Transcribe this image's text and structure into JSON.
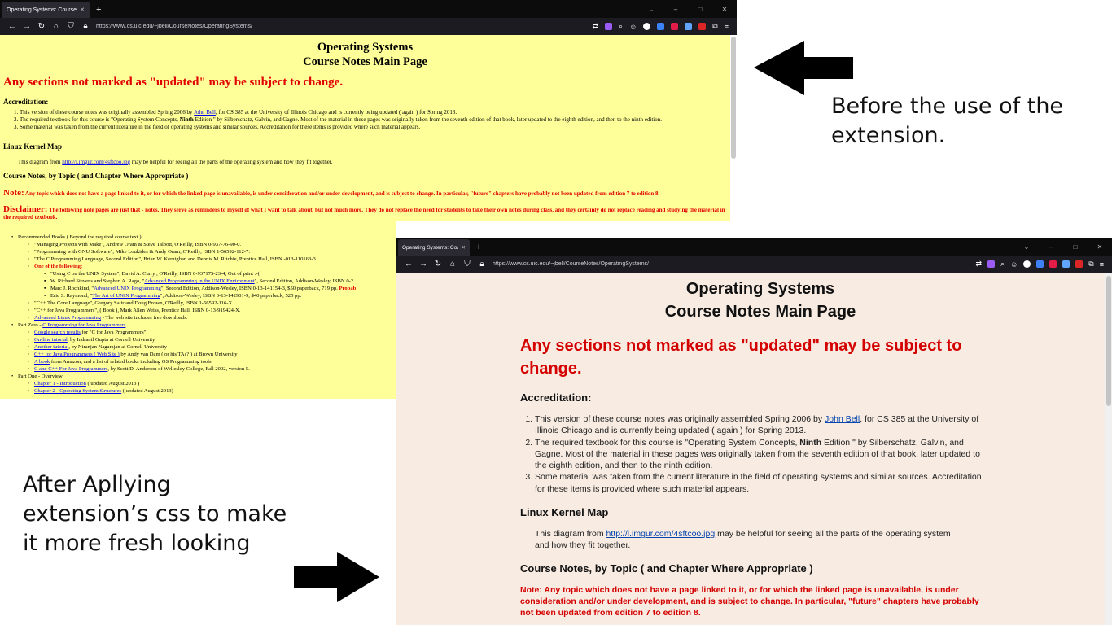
{
  "before": {
    "tab_title": "Operating Systems: Course Notes M",
    "new_tab_label": "+",
    "window_controls": [
      "⌄",
      "–",
      "□",
      "✕"
    ],
    "url": "https://www.cs.uic.edu/~jbell/CourseNotes/OperatingSystems/",
    "page_title_line1": "Operating Systems",
    "page_title_line2": "Course Notes Main Page",
    "warning": "Any sections not marked as \"updated\" may be subject to change.",
    "accreditation_heading": "Accreditation:",
    "accreditation_items": [
      {
        "pre": "This version of these course notes was originally assembled Spring 2006 by ",
        "link": "John Bell",
        "post": ", for CS 385 at the University of Illinois Chicago and is currently being updated ( again ) for Spring 2013."
      },
      {
        "pre": "The required textbook for this course is \"Operating System Concepts, ",
        "bold": "Ninth",
        "post": " Edition \" by Silberschatz, Galvin, and Gagne. Most of the material in these pages was originally taken from the seventh edition of that book, later updated to the eighth edition, and then to the ninth edition."
      },
      {
        "pre": "Some material was taken from the current literature in the field of operating systems and similar sources. Accreditation for these items is provided where such material appears."
      }
    ],
    "kernel_heading": "Linux Kernel Map",
    "kernel_pre": "This diagram from ",
    "kernel_link": "http://i.imgur.com/4sftcoo.jpg",
    "kernel_post": " may be helpful for seeing all the parts of the operating system and how they fit together.",
    "topics_heading": "Course Notes, by Topic ( and Chapter Where Appropriate )",
    "note_label": "Note:",
    "note_text": " Any topic which does not have a page linked to it, or for which the linked page is unavailable, is under consideration and/or under development, and is subject to change. In particular, \"future\" chapters have probably not been updated from edition 7 to edition 8.",
    "disclaimer_label": "Disclaimer:",
    "disclaimer_text": " The following note pages are just that - notes. They serve as reminders to myself of what I want to talk about, but not much more. They do not replace the need for students to take their own notes during class, and they certainly do not replace reading and studying the material in the required textbook.",
    "list": [
      {
        "level": 1,
        "text": "Recommended Books ( Beyond the required course text )"
      },
      {
        "level": 2,
        "text": "\"Managing Projects with Make\", Andrew Oram & Steve Talbott, O'Reilly, ISBN 0-937-76-90-0."
      },
      {
        "level": 2,
        "text": "\"Programming with GNU Software\", Mike Loukides & Andy Oram, O'Reilly, ISBN 1-56592-112-7."
      },
      {
        "level": 2,
        "text": "\"The C Programming Language, Second Edition\", Brian W. Kernighan and Dennis M. Ritchie, Prentice Hall, ISBN -013-110163-3."
      },
      {
        "level": 2,
        "red": "One of the following:"
      },
      {
        "level": 3,
        "text": "\"Using C on the UNIX System\", David A. Curry , O'Reilly, ISBN 0-937175-23-4, Out of print :-("
      },
      {
        "level": 3,
        "pre": "W. Richard Stevens and Stephen A. Rago, \"",
        "link": "Advanced Programming in the UNIX Environment",
        "post": "\", Second Edition, Addison-Wesley, ISBN 0-2"
      },
      {
        "level": 3,
        "pre": "Marc J. Rochkind, \"",
        "link": "Advanced UNIX Programming",
        "post": "\", Second Edition, Addison-Wesley, ISBN 0-13-141154-3, $50 paperback, 719 pp. ",
        "red": "Probab"
      },
      {
        "level": 3,
        "pre": "Eric S. Raymond, \"",
        "link": "The Art of UNIX Programming",
        "post": "\", Addison-Wesley, ISBN 0-13-142901-9, $40 paperback, 525 pp."
      },
      {
        "level": 2,
        "text": "\"C++ The Core Language\", Gregory Satir and Doug Brown, O'Reilly, ISBN 1-56592-116-X."
      },
      {
        "level": 2,
        "text": "\"C++ for Java Programmers\", ( Book ), Mark Allen Weiss, Prentice Hall, ISBN 0-13-919424-X."
      },
      {
        "level": 2,
        "link": "Advanced Linux Programming",
        "post": " - The web site includes free downloads."
      },
      {
        "level": 1,
        "pre": "Part Zero - ",
        "link": "C Programming for Java Programmers"
      },
      {
        "level": 2,
        "link": "Google search results",
        "post": " for \"C for Java Programmers\""
      },
      {
        "level": 2,
        "link": "On-line tutorial",
        "post": ", by Indranil Gupta at Cornell University"
      },
      {
        "level": 2,
        "link": "Another tutorial",
        "post": ", by Niranjan Nagarajan at Cornell University"
      },
      {
        "level": 2,
        "link": "C++ for Java Programmers ( Web Site )",
        "post": " by Andy van Dam ( or his TAs? ) at Brown University"
      },
      {
        "level": 2,
        "link": "A book",
        "post": " from Amazon, and a list of related books including OS Programming tools."
      },
      {
        "level": 2,
        "link": "C and C++ For Java Programmers",
        "post": ", by Scott D. Anderson of Wellesley College, Fall 2002, version 5."
      },
      {
        "level": 1,
        "text": "Part One - Overview"
      },
      {
        "level": 2,
        "link": "Chapter 1 - Introduction",
        "post": " ( updated August 2013 )"
      },
      {
        "level": 2,
        "link": "Chapter 2 - Operating System Structures",
        "post": " ( updated August 2013)"
      }
    ]
  },
  "after": {
    "tab_title": "Operating Systems: Course Notes M",
    "new_tab_label": "+",
    "window_controls": [
      "⌄",
      "–",
      "□",
      "✕"
    ],
    "url": "https://www.cs.uic.edu/~jbell/CourseNotes/OperatingSystems/",
    "page_title_line1": "Operating Systems",
    "page_title_line2": "Course Notes Main Page",
    "warning": "Any sections not marked as \"updated\" may be subject to change.",
    "accreditation_heading": "Accreditation:",
    "accreditation_items": [
      {
        "pre": "This version of these course notes was originally assembled Spring 2006 by ",
        "link": "John Bell",
        "post": ", for CS 385 at the University of Illinois Chicago and is currently being updated ( again ) for Spring 2013."
      },
      {
        "pre": "The required textbook for this course is \"Operating System Concepts, ",
        "bold": "Ninth",
        "post": " Edition \" by Silberschatz, Galvin, and Gagne. Most of the material in these pages was originally taken from the seventh edition of that book, later updated to the eighth edition, and then to the ninth edition."
      },
      {
        "pre": "Some material was taken from the current literature in the field of operating systems and similar sources. Accreditation for these items is provided where such material appears."
      }
    ],
    "kernel_heading": "Linux Kernel Map",
    "kernel_pre": "This diagram from ",
    "kernel_link": "http://i.imgur.com/4sftcoo.jpg",
    "kernel_post": " may be helpful for seeing all the parts of the operating system and how they fit together.",
    "topics_heading": "Course Notes, by Topic ( and Chapter Where Appropriate )",
    "note_label": "Note:",
    "note_text": " Any topic which does not have a page linked to it, or for which the linked page is unavailable, is under consideration and/or under development, and is subject to change. In particular, \"future\" chapters have probably not been updated from edition 7 to edition 8."
  },
  "captions": {
    "before": "Before the use of the extension.",
    "after_line1": "After Apllying",
    "after_line2": "extension’s css to make",
    "after_line3": "it more fresh looking"
  },
  "nav_icons": [
    "back-arrow-icon",
    "forward-arrow-icon",
    "reload-icon",
    "home-icon",
    "shield-icon",
    "lock-icon"
  ],
  "colors": {
    "old_page_bg": "#ffff99",
    "new_page_bg": "#f7ebe2",
    "warning_red": "#e00000",
    "link_blue": "#0000ee",
    "browser_chrome": "#1c1b22"
  }
}
